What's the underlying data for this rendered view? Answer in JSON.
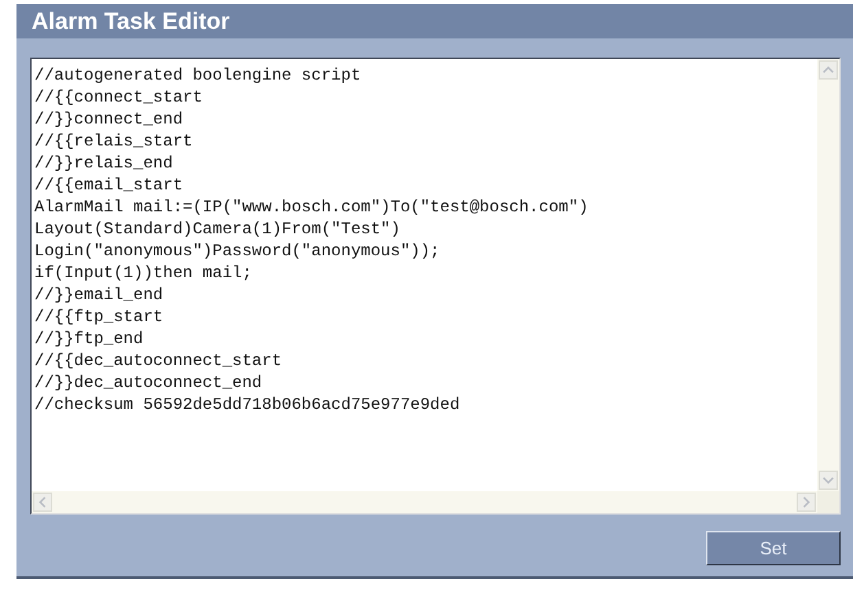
{
  "panel": {
    "title": "Alarm Task Editor"
  },
  "editor": {
    "lines": [
      "//autogenerated boolengine script",
      "//{{connect_start",
      "//}}connect_end",
      "//{{relais_start",
      "//}}relais_end",
      "//{{email_start",
      "AlarmMail mail:=(IP(\"www.bosch.com\")To(\"test@bosch.com\")",
      "Layout(Standard)Camera(1)From(\"Test\")",
      "Login(\"anonymous\")Password(\"anonymous\"));",
      "if(Input(1))then mail;",
      "//}}email_end",
      "//{{ftp_start",
      "//}}ftp_end",
      "//{{dec_autoconnect_start",
      "//}}dec_autoconnect_end",
      "//checksum 56592de5dd718b06b6acd75e977e9ded"
    ]
  },
  "buttons": [
    {
      "label": "Set"
    }
  ]
}
